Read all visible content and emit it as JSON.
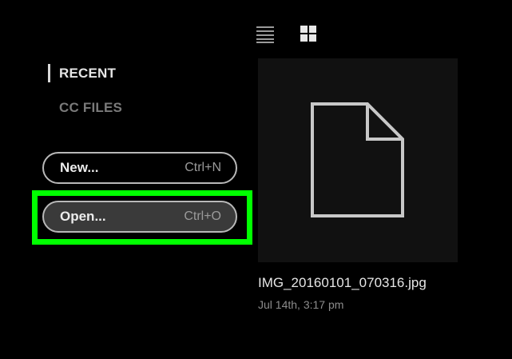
{
  "toolbar": {
    "list_view_icon": "list-view-icon",
    "grid_view_icon": "grid-view-icon"
  },
  "nav": {
    "recent_label": "RECENT",
    "cc_files_label": "CC FILES"
  },
  "actions": {
    "new": {
      "label": "New...",
      "shortcut": "Ctrl+N"
    },
    "open": {
      "label": "Open...",
      "shortcut": "Ctrl+O"
    }
  },
  "recent_files": [
    {
      "name": "IMG_20160101_070316.jpg",
      "date": "Jul 14th, 3:17 pm",
      "icon": "document-icon"
    }
  ],
  "colors": {
    "background": "#000000",
    "highlight": "#00ff00",
    "thumbnail_bg": "#111111",
    "active_nav": "#e6e6e6",
    "inactive_nav": "#7a7a7a"
  }
}
